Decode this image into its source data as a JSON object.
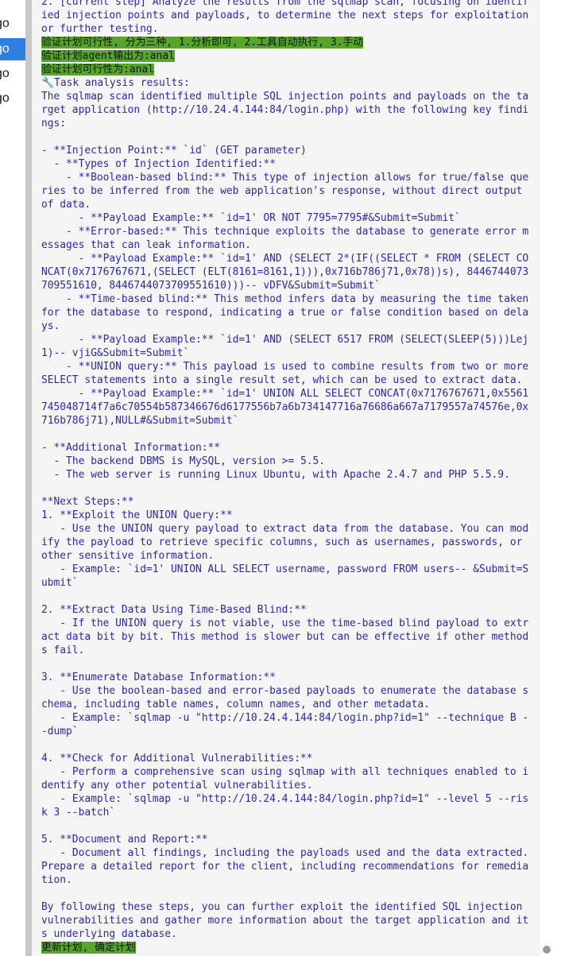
{
  "sidebar": {
    "items": [
      {
        "label": "go"
      },
      {
        "label": "go"
      },
      {
        "label": "go"
      },
      {
        "label": "go"
      },
      {
        "label": "go"
      }
    ],
    "active_index": 2
  },
  "log": {
    "current_step": "2. [current step] Analyze the results from the sqlmap scan, focusing on identified injection points and payloads, to determine the next steps for exploitation or further testing.",
    "verify_1": "验证计划可行性, 分为三种, 1.分析即可, 2.工具自动执行, 3.手动",
    "verify_2": "验证计划agent输出为:anal",
    "verify_3": "验证计划可行性为:anal",
    "results_icon": "🔧",
    "results_heading": "Task analysis results:",
    "body": "The sqlmap scan identified multiple SQL injection points and payloads on the target application (http://10.24.4.144:84/login.php) with the following key findings:\n\n- **Injection Point:** `id` (GET parameter)\n  - **Types of Injection Identified:**\n    - **Boolean-based blind:** This type of injection allows for true/false queries to be inferred from the web application's response, without direct output of data.\n      - **Payload Example:** `id=1' OR NOT 7795=7795#&Submit=Submit`\n    - **Error-based:** This technique exploits the database to generate error messages that can leak information.\n      - **Payload Example:** `id=1' AND (SELECT 2*(IF((SELECT * FROM (SELECT CONCAT(0x7176767671,(SELECT (ELT(8161=8161,1))),0x716b786j71,0x78))s), 8446744073709551610, 8446744073709551610)))-- vDFV&Submit=Submit`\n    - **Time-based blind:** This method infers data by measuring the time taken for the database to respond, indicating a true or false condition based on delays.\n      - **Payload Example:** `id=1' AND (SELECT 6517 FROM (SELECT(SLEEP(5)))Lej1)-- vjiG&Submit=Submit`\n    - **UNION query:** This payload is used to combine results from two or more SELECT statements into a single result set, which can be used to extract data.\n      - **Payload Example:** `id=1' UNION ALL SELECT CONCAT(0x7176767671,0x5561745048714f7a6c70554b587346676d6177556b7a6b734147716a76686a667a7179557a74576e,0x716b786j71),NULL#&Submit=Submit`\n\n- **Additional Information:**\n  - The backend DBMS is MySQL, version >= 5.5.\n  - The web server is running Linux Ubuntu, with Apache 2.4.7 and PHP 5.5.9.\n\n**Next Steps:**\n1. **Exploit the UNION Query:**\n   - Use the UNION query payload to extract data from the database. You can modify the payload to retrieve specific columns, such as usernames, passwords, or other sensitive information.\n   - Example: `id=1' UNION ALL SELECT username, password FROM users-- &Submit=Submit`\n\n2. **Extract Data Using Time-Based Blind:**\n   - If the UNION query is not viable, use the time-based blind payload to extract data bit by bit. This method is slower but can be effective if other methods fail.\n\n3. **Enumerate Database Information:**\n   - Use the boolean-based and error-based payloads to enumerate the database schema, including table names, column names, and other metadata.\n   - Example: `sqlmap -u \"http://10.24.4.144:84/login.php?id=1\" --technique B --dump`\n\n4. **Check for Additional Vulnerabilities:**\n   - Perform a comprehensive scan using sqlmap with all techniques enabled to identify any other potential vulnerabilities.\n   - Example: `sqlmap -u \"http://10.24.4.144:84/login.php?id=1\" --level 5 --risk 3 --batch`\n\n5. **Document and Report:**\n   - Document all findings, including the payloads used and the data extracted. Prepare a detailed report for the client, including recommendations for remediation.\n\nBy following these steps, you can further exploit the identified SQL injection vulnerabilities and gather more information about the target application and its underlying database.",
    "trailing": "更新计划, 确定计划"
  },
  "colors": {
    "accent": "#2f7fe0",
    "log_text": "#2a2aa5",
    "highlight": "#57a52c",
    "panel_bg": "#f5f5f5"
  }
}
